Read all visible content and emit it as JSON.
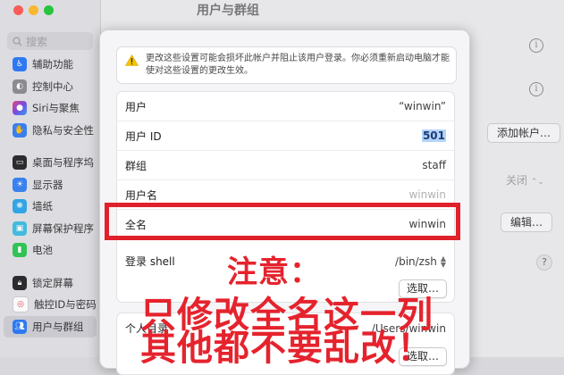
{
  "window": {
    "title": "用户与群组",
    "traffic_colors": [
      "#fe5f57",
      "#febc2e",
      "#28c840"
    ]
  },
  "sidebar": {
    "search_placeholder": "搜索",
    "items": [
      {
        "label": "辅助功能",
        "icon": "accessibility-icon",
        "color": "#2f7cf6"
      },
      {
        "label": "控制中心",
        "icon": "control-center-icon",
        "color": "#8e8e93"
      },
      {
        "label": "Siri与聚焦",
        "icon": "siri-icon",
        "color": "#c64be0"
      },
      {
        "label": "隐私与安全性",
        "icon": "hand-icon",
        "color": "#3d82f3"
      },
      {
        "label": "桌面与程序坞",
        "icon": "dock-icon",
        "color": "#2d2d30"
      },
      {
        "label": "显示器",
        "icon": "display-icon",
        "color": "#3b84f4"
      },
      {
        "label": "墙纸",
        "icon": "wallpaper-icon",
        "color": "#35a8e8"
      },
      {
        "label": "屏幕保护程序",
        "icon": "screensaver-icon",
        "color": "#44bfe2"
      },
      {
        "label": "电池",
        "icon": "battery-icon",
        "color": "#34c759"
      },
      {
        "label": "锁定屏幕",
        "icon": "lock-icon",
        "color": "#2d2d30"
      },
      {
        "label": "触控ID与密码",
        "icon": "touch-id-icon",
        "color": "#ffffff"
      },
      {
        "label": "用户与群组",
        "icon": "users-icon",
        "color": "#2f7cf6"
      }
    ]
  },
  "background_controls": {
    "add_account_label": "添加帐户…",
    "off_label": "关闭",
    "edit_label": "编辑…",
    "help_label": "?"
  },
  "dialog": {
    "warning": "更改这些设置可能会损坏此帐户并阻止该用户登录。你必须重新启动电脑才能使对这些设置的更改生效。",
    "rows": [
      {
        "label": "用户",
        "value": "“winwin”"
      },
      {
        "label": "用户 ID",
        "value": "501"
      },
      {
        "label": "群组",
        "value": "staff"
      },
      {
        "label": "用户名",
        "value": "winwin"
      },
      {
        "label": "全名",
        "value": "winwin"
      },
      {
        "label": "登录 shell",
        "value": "/bin/zsh"
      }
    ],
    "choose_label": "选取…",
    "home_label": "个人目录",
    "home_value": "/Users/winwin",
    "choose_label_2": "选取…"
  },
  "annotation": {
    "line1": "注意：",
    "line2": "只修改全名这一列",
    "line3": "其他都不要乱改！",
    "color": "#e0202a"
  }
}
